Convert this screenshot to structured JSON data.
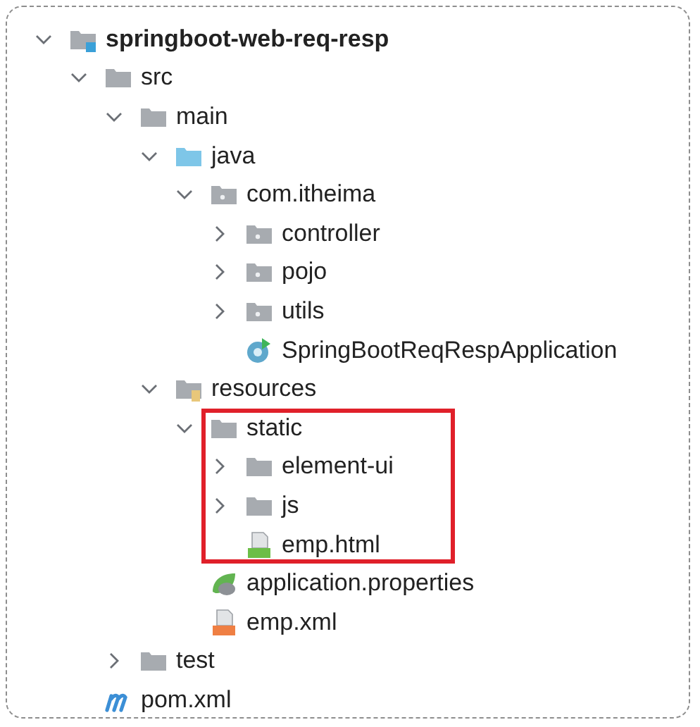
{
  "tree": [
    {
      "name": "springboot-web-req-resp",
      "kind": "project",
      "expanded": true,
      "children": [
        {
          "name": "src",
          "kind": "folder",
          "expanded": true,
          "children": [
            {
              "name": "main",
              "kind": "folder",
              "expanded": true,
              "children": [
                {
                  "name": "java",
                  "kind": "source",
                  "expanded": true,
                  "children": [
                    {
                      "name": "com.itheima",
                      "kind": "package",
                      "expanded": true,
                      "children": [
                        {
                          "name": "controller",
                          "kind": "package",
                          "expanded": false
                        },
                        {
                          "name": "pojo",
                          "kind": "package",
                          "expanded": false
                        },
                        {
                          "name": "utils",
                          "kind": "package",
                          "expanded": false
                        },
                        {
                          "name": "SpringBootReqRespApplication",
                          "kind": "class"
                        }
                      ]
                    }
                  ]
                },
                {
                  "name": "resources",
                  "kind": "resources",
                  "expanded": true,
                  "children": [
                    {
                      "name": "static",
                      "kind": "folder",
                      "expanded": true,
                      "highlighted": true,
                      "children": [
                        {
                          "name": "element-ui",
                          "kind": "folder",
                          "expanded": false
                        },
                        {
                          "name": "js",
                          "kind": "folder",
                          "expanded": false
                        },
                        {
                          "name": "emp.html",
                          "kind": "html"
                        }
                      ]
                    },
                    {
                      "name": "application.properties",
                      "kind": "properties"
                    },
                    {
                      "name": "emp.xml",
                      "kind": "xml"
                    }
                  ]
                }
              ]
            },
            {
              "name": "test",
              "kind": "folder",
              "expanded": false
            }
          ]
        },
        {
          "name": "pom.xml",
          "kind": "maven"
        }
      ]
    }
  ]
}
